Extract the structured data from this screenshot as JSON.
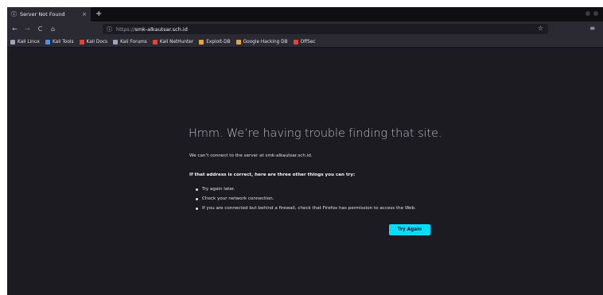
{
  "tab": {
    "title": "Server Not Found",
    "close": "×",
    "new_tab": "+"
  },
  "nav": {
    "back": "←",
    "forward": "→",
    "reload": "C",
    "home": "⌂",
    "menu": "≡",
    "star": "☆"
  },
  "url": {
    "info_icon": "ⓘ",
    "prefix": "https://",
    "host": "smk-alkautsar.sch.id"
  },
  "bookmarks": [
    {
      "label": "Kali Linux",
      "icon": "kali-dragon-icon",
      "color": "#9aa6b8"
    },
    {
      "label": "Kali Tools",
      "icon": "kali-tools-icon",
      "color": "#4f8fe6"
    },
    {
      "label": "Kali Docs",
      "icon": "kali-docs-icon",
      "color": "#e0453a"
    },
    {
      "label": "Kali Forums",
      "icon": "kali-forums-icon",
      "color": "#9aa6b8"
    },
    {
      "label": "Kali NetHunter",
      "icon": "nethunter-icon",
      "color": "#e0453a"
    },
    {
      "label": "Exploit-DB",
      "icon": "exploit-db-icon",
      "color": "#e8a33a"
    },
    {
      "label": "Google Hacking DB",
      "icon": "ghdb-icon",
      "color": "#e8a33a"
    },
    {
      "label": "OffSec",
      "icon": "offsec-icon",
      "color": "#e0453a"
    }
  ],
  "error": {
    "title": "Hmm. We’re having trouble finding that site.",
    "description": "We can’t connect to the server at smk-alkautsar.sch.id.",
    "subtitle": "If that address is correct, here are three other things you can try:",
    "items": [
      "Try again later.",
      "Check your network connection.",
      "If you are connected but behind a firewall, check that Firefox has permission to access the Web."
    ],
    "button": "Try Again"
  }
}
